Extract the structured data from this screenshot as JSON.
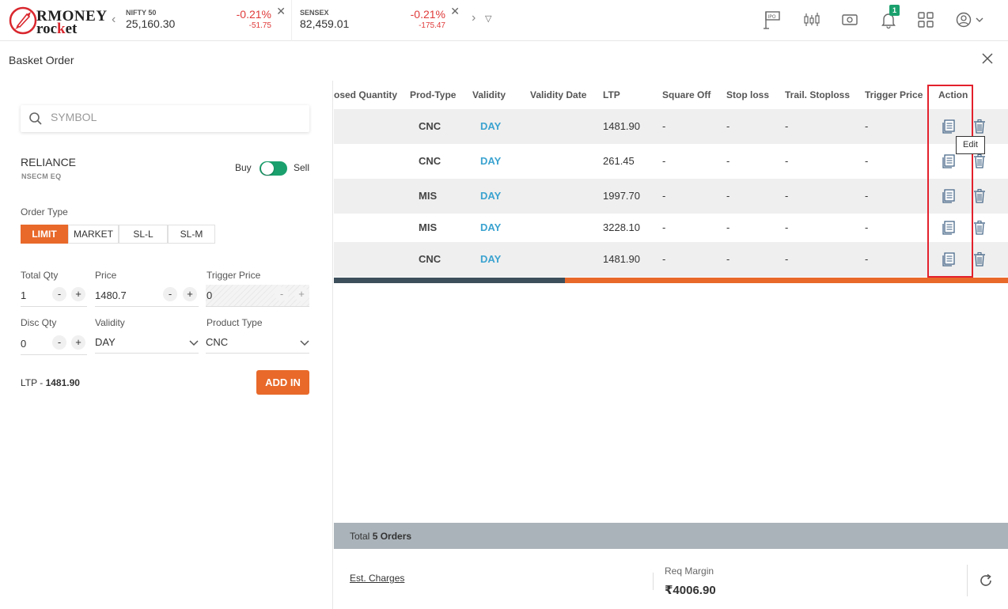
{
  "header": {
    "logo_top": "RMONEY",
    "logo_bottom_prefix": "roc",
    "logo_bottom_k": "k",
    "logo_bottom_suffix": "et",
    "indices": [
      {
        "name": "NIFTY 50",
        "value": "25,160.30",
        "pct": "-0.21%",
        "change": "-51.75"
      },
      {
        "name": "SENSEX",
        "value": "82,459.01",
        "pct": "-0.21%",
        "change": "-175.47"
      }
    ],
    "notification_count": "1",
    "icons": [
      "ipo-icon",
      "chart-candle-icon",
      "cash-icon",
      "bell-icon",
      "grid-icon",
      "user-icon"
    ]
  },
  "page": {
    "title": "Basket Order"
  },
  "form": {
    "search_placeholder": "SYMBOL",
    "symbol": "RELIANCE",
    "exchange": "NSECM  EQ",
    "buy_label": "Buy",
    "sell_label": "Sell",
    "order_type_label": "Order Type",
    "order_types": [
      "LIMIT",
      "MARKET",
      "SL-L",
      "SL-M"
    ],
    "active_order_type": "LIMIT",
    "total_qty_label": "Total Qty",
    "total_qty": "1",
    "price_label": "Price",
    "price": "1480.7",
    "trigger_price_label": "Trigger Price",
    "trigger_price": "0",
    "disc_qty_label": "Disc Qty",
    "disc_qty": "0",
    "validity_label": "Validity",
    "validity": "DAY",
    "product_type_label": "Product Type",
    "product_type": "CNC",
    "ltp_label": "LTP - ",
    "ltp_value": "1481.90",
    "add_button": "ADD IN",
    "minus": "-",
    "plus": "+"
  },
  "table": {
    "columns": [
      "osed Quantity",
      "Prod-Type",
      "Validity",
      "Validity Date",
      "LTP",
      "Square Off",
      "Stop loss",
      "Trail. Stoploss",
      "Trigger Price",
      "Action"
    ],
    "rows": [
      {
        "prod": "CNC",
        "validity": "DAY",
        "ltp": "1481.90",
        "sq": "-",
        "sl": "-",
        "tsl": "-",
        "tp": "-"
      },
      {
        "prod": "CNC",
        "validity": "DAY",
        "ltp": "261.45",
        "sq": "-",
        "sl": "-",
        "tsl": "-",
        "tp": "-"
      },
      {
        "prod": "MIS",
        "validity": "DAY",
        "ltp": "1997.70",
        "sq": "-",
        "sl": "-",
        "tsl": "-",
        "tp": "-"
      },
      {
        "prod": "MIS",
        "validity": "DAY",
        "ltp": "3228.10",
        "sq": "-",
        "sl": "-",
        "tsl": "-",
        "tp": "-"
      },
      {
        "prod": "CNC",
        "validity": "DAY",
        "ltp": "1481.90",
        "sq": "-",
        "sl": "-",
        "tsl": "-",
        "tp": "-"
      }
    ],
    "tooltip": "Edit",
    "progress_fraction": 0.343
  },
  "summary": {
    "total_prefix": "Total ",
    "total_orders": "5 Orders",
    "est_charges": "Est. Charges",
    "req_margin_label": "Req Margin",
    "req_margin_value": "₹4006.90"
  },
  "colors": {
    "accent": "#e8692a",
    "toggle": "#1aa06d",
    "negative": "#e03a3a",
    "day": "#3ba3d0",
    "highlight": "#e3212c"
  }
}
